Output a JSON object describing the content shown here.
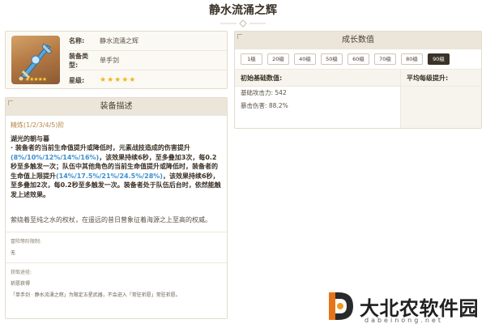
{
  "page": {
    "title": "静水流涌之辉"
  },
  "info": {
    "name_label": "名称:",
    "name_value": "静水流涌之辉",
    "type_label": "装备类型:",
    "type_value": "单手剑",
    "rarity_label": "星级:",
    "rarity_stars": "★★★★★",
    "thumb_stars": "★★★★★"
  },
  "description": {
    "header": "装备描述",
    "refine": "精炼(1/2/3/4/5)阶",
    "passive_title": "湖光的朝与暮",
    "passive_p1": "· 装备者的当前生命值提升或降低时，元素战技造成的伤害提升",
    "passive_p1_blue": "(8%/10%/12%/14%/16%)",
    "passive_p2": "，该效果持续6秒，至多叠加3次，每0.2秒至多触发一次；队伍中其他角色的当前生命值提升或降低时，装备者的生命值上限提升",
    "passive_p2_blue": "(14%/17.5%/21%/24.5%/28%)",
    "passive_p3": "，该效果持续6秒，至多叠加2次，每0.2秒至多触发一次。装备者处于队伍后台时，依然能触发上述效果。",
    "lore": "萦绕着至纯之水的权杖，在遥远的昔日曾象征着海源之上至高的权威。",
    "obtain_label": "冒险等阶限制:",
    "obtain_value": "无",
    "source_label": "获取途径:",
    "source_value": "祈愿获得",
    "source_note": "「单手剑 · 静水流涌之辉」为限定五星武器，不会进入「常驻祈愿」常驻祈愿。"
  },
  "growth": {
    "header": "成长数值",
    "levels": [
      "1级",
      "20级",
      "40级",
      "50级",
      "60级",
      "70级",
      "80级",
      "90级"
    ],
    "active_level": "90级",
    "base_head": "初始基础数值:",
    "avg_head": "平均每级提升:",
    "stat_atk": "基础攻击力: 542",
    "stat_cd": "暴击伤害: 88.2%"
  },
  "watermark": {
    "text": "大北农软件园",
    "url": "dabeinong.net"
  },
  "colors": {
    "accent": "#3a8fd0",
    "header_bg": "#ece6da",
    "active_tab": "#3b3228",
    "star": "#f2b51d"
  }
}
